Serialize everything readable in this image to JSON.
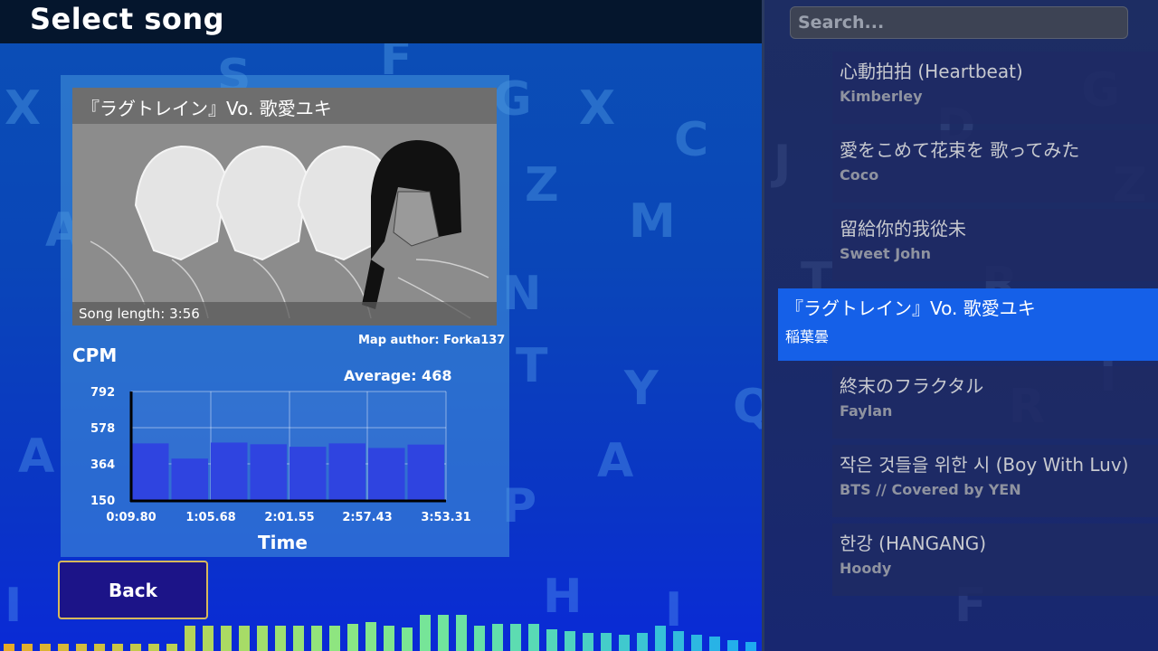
{
  "header": {
    "title": "Select song"
  },
  "search": {
    "placeholder": "Search..."
  },
  "selected_song": {
    "title": "『ラグトレイン』Vo. 歌愛ユキ",
    "song_length": "Song length: 3:56",
    "map_author": "Map author: Forka137"
  },
  "chart_data": {
    "type": "bar",
    "title": "",
    "ylabel": "CPM",
    "xlabel": "Time",
    "annotation": "Average: 468",
    "ylim": [
      150,
      792
    ],
    "yticks": [
      "792",
      "578",
      "364",
      "150"
    ],
    "xticks": [
      "0:09.80",
      "1:05.68",
      "2:01.55",
      "2:57.43",
      "3:53.31"
    ],
    "values": [
      485,
      395,
      490,
      480,
      465,
      485,
      458,
      478
    ],
    "bar_color": "#2f44e0",
    "grid": true
  },
  "back_button": {
    "label": "Back"
  },
  "song_list": [
    {
      "title": "心動拍拍 (Heartbeat)",
      "artist": "Kimberley"
    },
    {
      "title": "愛をこめて花束を 歌ってみた",
      "artist": "Coco"
    },
    {
      "title": "留給你的我從未",
      "artist": "Sweet John"
    },
    {
      "title": "『ラグトレイン』Vo. 歌愛ユキ",
      "artist": "稲葉曇"
    },
    {
      "title": "終末のフラクタル",
      "artist": "Faylan"
    },
    {
      "title": "작은 것들을 위한 시 (Boy With Luv)",
      "artist": "BTS // Covered by YEN"
    },
    {
      "title": "한강 (HANGANG)",
      "artist": "Hoody"
    }
  ],
  "colors": {
    "accent": "#1560e8",
    "back_border": "#d8b85a",
    "back_bg": "#1c1488"
  }
}
